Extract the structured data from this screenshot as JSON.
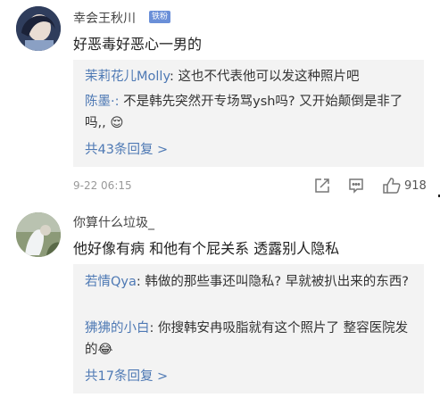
{
  "comments": [
    {
      "username": "幸会王秋川",
      "badge": "铁粉",
      "text": "好恶毒好恶心一男的",
      "replies": [
        {
          "nick": "茉莉花儿Molly",
          "text": ": 这也不代表他可以发这种照片吧"
        },
        {
          "nick": "陈墨·:",
          "text": " 不是韩先突然开专场骂ysh吗? 又开始颠倒是非了吗,, ",
          "emoji": "😌"
        }
      ],
      "more_replies": "共43条回复 >",
      "timestamp": "9-22 06:15",
      "like_count": "918"
    },
    {
      "username": "你算什么垃圾_",
      "text": "他好像有病 和他有个屁关系 透露别人隐私",
      "replies": [
        {
          "nick": "若情Qya",
          "text": ": 韩做的那些事还叫隐私? 早就被扒出来的东西?"
        },
        {
          "nick": "狒狒的小白",
          "text": ": 你搜韩安冉吸脂就有这个照片了 整容医院发的",
          "emoji": "😂"
        }
      ],
      "more_replies": "共17条回复 >"
    }
  ],
  "icons": [
    "share-icon",
    "comment-icon",
    "like-icon"
  ],
  "colors": {
    "link": "#4e79b4",
    "reply_bg": "#f3f3f3",
    "badge": "#6a8fd8"
  }
}
